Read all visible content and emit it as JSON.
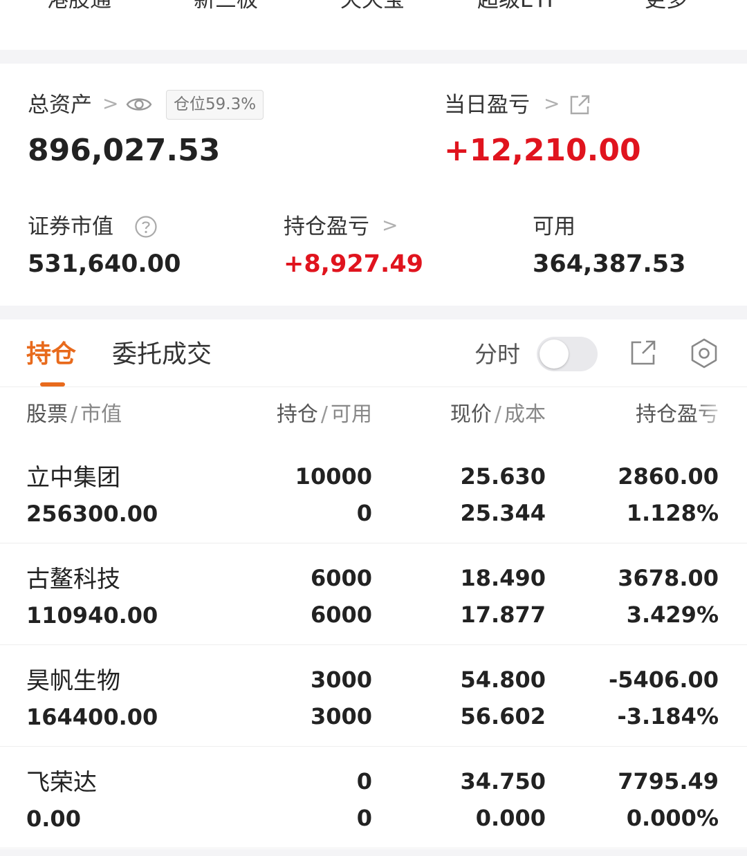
{
  "topnav": {
    "items": [
      "港股通",
      "新三板",
      "天天宝",
      "超级ETF",
      "更多"
    ]
  },
  "assets": {
    "total_label": "总资产",
    "position_badge": "仓位59.3%",
    "total_value": "896,027.53",
    "daily_pl_label": "当日盈亏",
    "daily_pl_value": "+12,210.00",
    "market_value_label": "证券市值",
    "market_value": "531,640.00",
    "holding_pl_label": "持仓盈亏",
    "holding_pl_value": "+8,927.49",
    "available_label": "可用",
    "available_value": "364,387.53"
  },
  "tabs": {
    "items": [
      "持仓",
      "委托成交"
    ],
    "active": "持仓",
    "timeshare_label": "分时",
    "timeshare_on": false
  },
  "table": {
    "headers": [
      {
        "main": "股票",
        "sub": "市值"
      },
      {
        "main": "持仓",
        "sub": "可用"
      },
      {
        "main": "现价",
        "sub": "成本"
      },
      {
        "main": "持仓盈亏"
      }
    ],
    "rows": [
      {
        "name": "立中集团",
        "market_value": "256300.00",
        "holding": "10000",
        "available": "0",
        "price": "25.630",
        "cost": "25.344",
        "pl": "2860.00",
        "pl_pct": "1.128%",
        "trend": "up"
      },
      {
        "name": "古鳌科技",
        "market_value": "110940.00",
        "holding": "6000",
        "available": "6000",
        "price": "18.490",
        "cost": "17.877",
        "pl": "3678.00",
        "pl_pct": "3.429%",
        "trend": "up"
      },
      {
        "name": "昊帆生物",
        "market_value": "164400.00",
        "holding": "3000",
        "available": "3000",
        "price": "54.800",
        "cost": "56.602",
        "pl": "-5406.00",
        "pl_pct": "-3.184%",
        "trend": "down"
      },
      {
        "name": "飞荣达",
        "market_value": "0.00",
        "holding": "0",
        "available": "0",
        "price": "34.750",
        "cost": "0.000",
        "pl": "7795.49",
        "pl_pct": "0.000%",
        "trend": "up"
      }
    ]
  },
  "colors": {
    "up": "#e0141e",
    "down": "#1e9e52",
    "accent": "#e86a1c"
  },
  "icons": [
    "chevron-right-icon",
    "eye-icon",
    "share-external-icon",
    "help-circle-icon",
    "gear-icon"
  ]
}
